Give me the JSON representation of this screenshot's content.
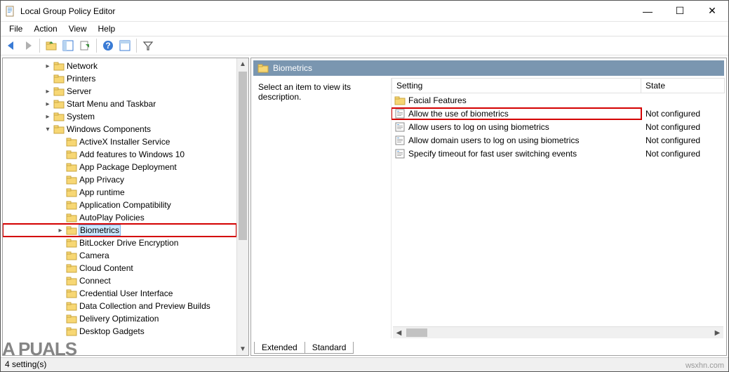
{
  "title": "Local Group Policy Editor",
  "menus": [
    "File",
    "Action",
    "View",
    "Help"
  ],
  "tree": [
    {
      "depth": 2,
      "toggle": ">",
      "label": "Network"
    },
    {
      "depth": 2,
      "toggle": "",
      "label": "Printers"
    },
    {
      "depth": 2,
      "toggle": ">",
      "label": "Server"
    },
    {
      "depth": 2,
      "toggle": ">",
      "label": "Start Menu and Taskbar"
    },
    {
      "depth": 2,
      "toggle": ">",
      "label": "System"
    },
    {
      "depth": 2,
      "toggle": "v",
      "label": "Windows Components"
    },
    {
      "depth": 3,
      "toggle": "",
      "label": "ActiveX Installer Service"
    },
    {
      "depth": 3,
      "toggle": "",
      "label": "Add features to Windows 10"
    },
    {
      "depth": 3,
      "toggle": "",
      "label": "App Package Deployment"
    },
    {
      "depth": 3,
      "toggle": "",
      "label": "App Privacy"
    },
    {
      "depth": 3,
      "toggle": "",
      "label": "App runtime"
    },
    {
      "depth": 3,
      "toggle": "",
      "label": "Application Compatibility"
    },
    {
      "depth": 3,
      "toggle": "",
      "label": "AutoPlay Policies"
    },
    {
      "depth": 3,
      "toggle": ">",
      "label": "Biometrics",
      "sel": true,
      "hl": true
    },
    {
      "depth": 3,
      "toggle": "",
      "label": "BitLocker Drive Encryption"
    },
    {
      "depth": 3,
      "toggle": "",
      "label": "Camera"
    },
    {
      "depth": 3,
      "toggle": "",
      "label": "Cloud Content"
    },
    {
      "depth": 3,
      "toggle": "",
      "label": "Connect"
    },
    {
      "depth": 3,
      "toggle": "",
      "label": "Credential User Interface"
    },
    {
      "depth": 3,
      "toggle": "",
      "label": "Data Collection and Preview Builds"
    },
    {
      "depth": 3,
      "toggle": "",
      "label": "Delivery Optimization"
    },
    {
      "depth": 3,
      "toggle": "",
      "label": "Desktop Gadgets"
    }
  ],
  "detail": {
    "heading": "Biometrics",
    "desc": "Select an item to view its description.",
    "headers": {
      "setting": "Setting",
      "state": "State"
    },
    "items": [
      {
        "type": "folder",
        "name": "Facial Features",
        "state": ""
      },
      {
        "type": "setting",
        "name": "Allow the use of biometrics",
        "state": "Not configured",
        "hl": true
      },
      {
        "type": "setting",
        "name": "Allow users to log on using biometrics",
        "state": "Not configured"
      },
      {
        "type": "setting",
        "name": "Allow domain users to log on using biometrics",
        "state": "Not configured"
      },
      {
        "type": "setting",
        "name": "Specify timeout for fast user switching events",
        "state": "Not configured"
      }
    ],
    "tabs": [
      "Extended",
      "Standard"
    ]
  },
  "status": "4 setting(s)",
  "watermark": "wsxhn.com",
  "brand": "A   PUALS"
}
